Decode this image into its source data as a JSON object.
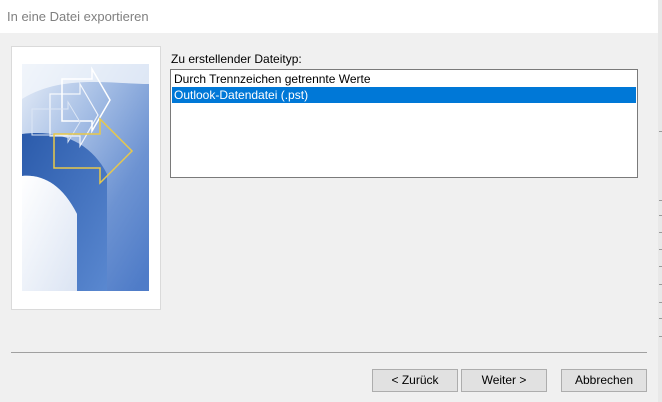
{
  "window": {
    "title": "In eine Datei exportieren"
  },
  "wizard_image": {
    "icon": "export-wizard-arrows-graphic",
    "colors": {
      "blue_dark": "#2a5caa",
      "blue_light": "#8fb1de",
      "arrow_yellow": "#e8c84a"
    }
  },
  "file_type": {
    "label": "Zu erstellender Dateityp:",
    "options": [
      "Durch Trennzeichen getrennte Werte",
      "Outlook-Datendatei (.pst)"
    ],
    "selected_index": 1,
    "selected_color": "#0078d7"
  },
  "buttons": {
    "back": "< Zurück",
    "next": "Weiter >",
    "cancel": "Abbrechen"
  }
}
